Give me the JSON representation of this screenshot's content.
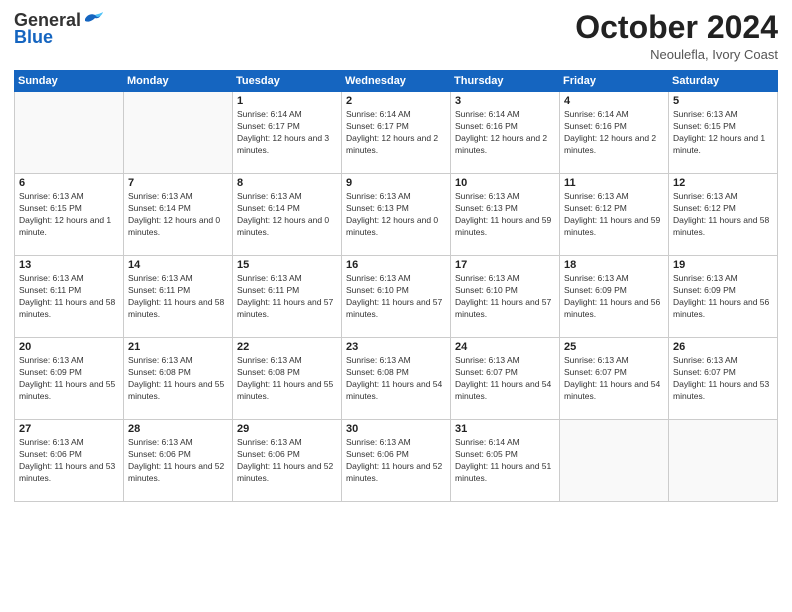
{
  "header": {
    "logo_general": "General",
    "logo_blue": "Blue",
    "title": "October 2024",
    "location": "Neoulefla, Ivory Coast"
  },
  "weekdays": [
    "Sunday",
    "Monday",
    "Tuesday",
    "Wednesday",
    "Thursday",
    "Friday",
    "Saturday"
  ],
  "weeks": [
    [
      {
        "day": "",
        "info": ""
      },
      {
        "day": "",
        "info": ""
      },
      {
        "day": "1",
        "info": "Sunrise: 6:14 AM\nSunset: 6:17 PM\nDaylight: 12 hours and 3 minutes."
      },
      {
        "day": "2",
        "info": "Sunrise: 6:14 AM\nSunset: 6:17 PM\nDaylight: 12 hours and 2 minutes."
      },
      {
        "day": "3",
        "info": "Sunrise: 6:14 AM\nSunset: 6:16 PM\nDaylight: 12 hours and 2 minutes."
      },
      {
        "day": "4",
        "info": "Sunrise: 6:14 AM\nSunset: 6:16 PM\nDaylight: 12 hours and 2 minutes."
      },
      {
        "day": "5",
        "info": "Sunrise: 6:13 AM\nSunset: 6:15 PM\nDaylight: 12 hours and 1 minute."
      }
    ],
    [
      {
        "day": "6",
        "info": "Sunrise: 6:13 AM\nSunset: 6:15 PM\nDaylight: 12 hours and 1 minute."
      },
      {
        "day": "7",
        "info": "Sunrise: 6:13 AM\nSunset: 6:14 PM\nDaylight: 12 hours and 0 minutes."
      },
      {
        "day": "8",
        "info": "Sunrise: 6:13 AM\nSunset: 6:14 PM\nDaylight: 12 hours and 0 minutes."
      },
      {
        "day": "9",
        "info": "Sunrise: 6:13 AM\nSunset: 6:13 PM\nDaylight: 12 hours and 0 minutes."
      },
      {
        "day": "10",
        "info": "Sunrise: 6:13 AM\nSunset: 6:13 PM\nDaylight: 11 hours and 59 minutes."
      },
      {
        "day": "11",
        "info": "Sunrise: 6:13 AM\nSunset: 6:12 PM\nDaylight: 11 hours and 59 minutes."
      },
      {
        "day": "12",
        "info": "Sunrise: 6:13 AM\nSunset: 6:12 PM\nDaylight: 11 hours and 58 minutes."
      }
    ],
    [
      {
        "day": "13",
        "info": "Sunrise: 6:13 AM\nSunset: 6:11 PM\nDaylight: 11 hours and 58 minutes."
      },
      {
        "day": "14",
        "info": "Sunrise: 6:13 AM\nSunset: 6:11 PM\nDaylight: 11 hours and 58 minutes."
      },
      {
        "day": "15",
        "info": "Sunrise: 6:13 AM\nSunset: 6:11 PM\nDaylight: 11 hours and 57 minutes."
      },
      {
        "day": "16",
        "info": "Sunrise: 6:13 AM\nSunset: 6:10 PM\nDaylight: 11 hours and 57 minutes."
      },
      {
        "day": "17",
        "info": "Sunrise: 6:13 AM\nSunset: 6:10 PM\nDaylight: 11 hours and 57 minutes."
      },
      {
        "day": "18",
        "info": "Sunrise: 6:13 AM\nSunset: 6:09 PM\nDaylight: 11 hours and 56 minutes."
      },
      {
        "day": "19",
        "info": "Sunrise: 6:13 AM\nSunset: 6:09 PM\nDaylight: 11 hours and 56 minutes."
      }
    ],
    [
      {
        "day": "20",
        "info": "Sunrise: 6:13 AM\nSunset: 6:09 PM\nDaylight: 11 hours and 55 minutes."
      },
      {
        "day": "21",
        "info": "Sunrise: 6:13 AM\nSunset: 6:08 PM\nDaylight: 11 hours and 55 minutes."
      },
      {
        "day": "22",
        "info": "Sunrise: 6:13 AM\nSunset: 6:08 PM\nDaylight: 11 hours and 55 minutes."
      },
      {
        "day": "23",
        "info": "Sunrise: 6:13 AM\nSunset: 6:08 PM\nDaylight: 11 hours and 54 minutes."
      },
      {
        "day": "24",
        "info": "Sunrise: 6:13 AM\nSunset: 6:07 PM\nDaylight: 11 hours and 54 minutes."
      },
      {
        "day": "25",
        "info": "Sunrise: 6:13 AM\nSunset: 6:07 PM\nDaylight: 11 hours and 54 minutes."
      },
      {
        "day": "26",
        "info": "Sunrise: 6:13 AM\nSunset: 6:07 PM\nDaylight: 11 hours and 53 minutes."
      }
    ],
    [
      {
        "day": "27",
        "info": "Sunrise: 6:13 AM\nSunset: 6:06 PM\nDaylight: 11 hours and 53 minutes."
      },
      {
        "day": "28",
        "info": "Sunrise: 6:13 AM\nSunset: 6:06 PM\nDaylight: 11 hours and 52 minutes."
      },
      {
        "day": "29",
        "info": "Sunrise: 6:13 AM\nSunset: 6:06 PM\nDaylight: 11 hours and 52 minutes."
      },
      {
        "day": "30",
        "info": "Sunrise: 6:13 AM\nSunset: 6:06 PM\nDaylight: 11 hours and 52 minutes."
      },
      {
        "day": "31",
        "info": "Sunrise: 6:14 AM\nSunset: 6:05 PM\nDaylight: 11 hours and 51 minutes."
      },
      {
        "day": "",
        "info": ""
      },
      {
        "day": "",
        "info": ""
      }
    ]
  ]
}
